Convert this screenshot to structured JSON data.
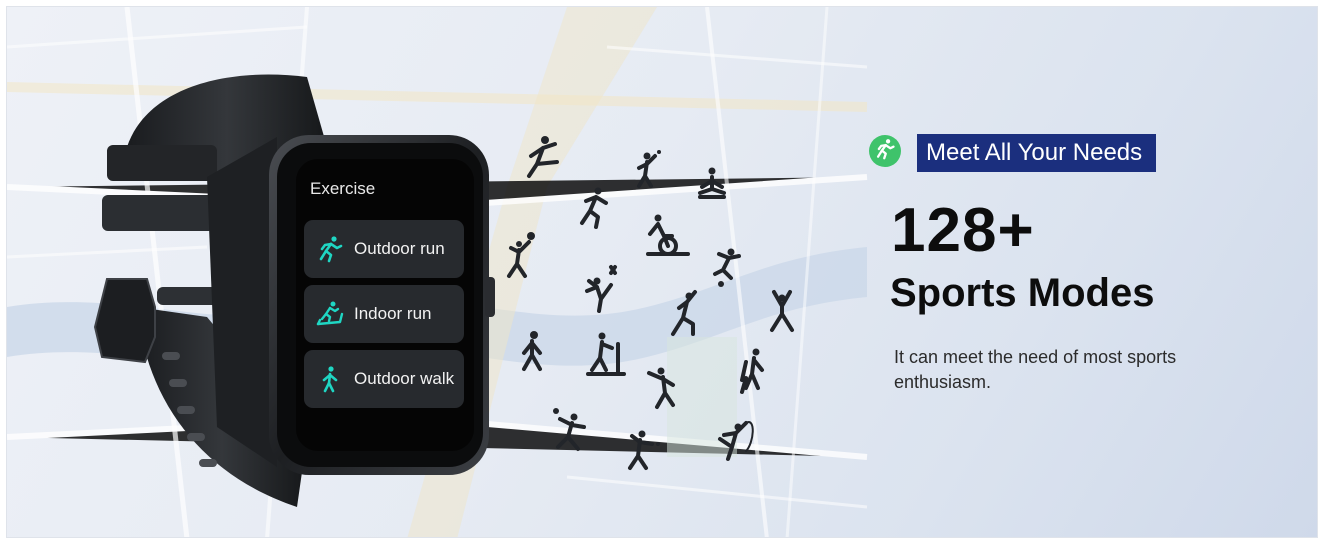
{
  "watch": {
    "screen_title": "Exercise",
    "tiles": [
      {
        "label": "Outdoor run",
        "icon": "runner-icon"
      },
      {
        "label": "Indoor run",
        "icon": "treadmill-icon"
      },
      {
        "label": "Outdoor walk",
        "icon": "walker-icon"
      }
    ],
    "accent_color": "#1fd6c3"
  },
  "sports_icons": [
    "kick-icon",
    "badminton-icon",
    "yoga-icon",
    "running-icon",
    "cycling-icon",
    "volleyball-icon",
    "football-icon",
    "taekwondo-icon",
    "dance-icon",
    "stretch-icon",
    "walking-icon",
    "rowing-icon",
    "hiking-icon",
    "cricket-icon",
    "tennis-icon",
    "table-tennis-icon",
    "gymnastics-icon"
  ],
  "headline": {
    "tag": "Meet All Your Needs",
    "tag_icon": "runner-icon",
    "tag_bg": "#1b2f7e",
    "badge_color": "#3fc36b",
    "number": "128+",
    "subtitle": "Sports Modes",
    "description": "It can meet the need of most sports enthusiasm."
  }
}
